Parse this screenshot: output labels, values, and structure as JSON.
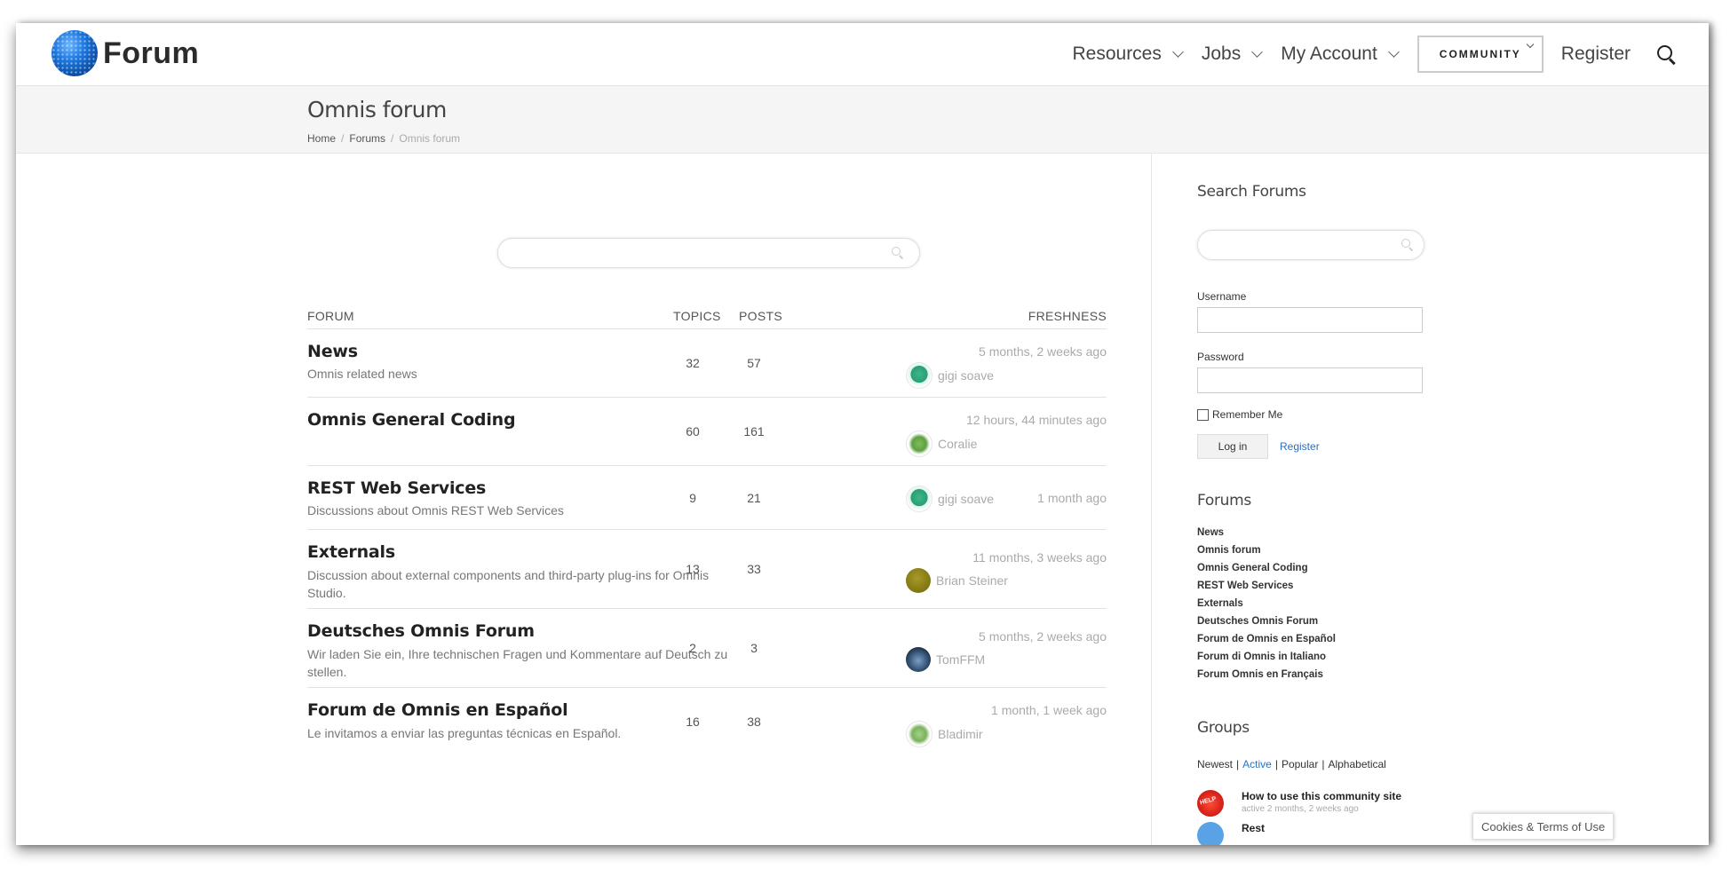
{
  "header": {
    "logo_text": "Forum",
    "nav": {
      "resources": "Resources",
      "jobs": "Jobs",
      "my_account": "My Account",
      "community": "COMMUNITY",
      "register": "Register"
    }
  },
  "titlebar": {
    "title": "Omnis forum",
    "breadcrumb": {
      "home": "Home",
      "forums": "Forums",
      "current": "Omnis forum"
    }
  },
  "table": {
    "headers": {
      "forum": "FORUM",
      "topics": "TOPICS",
      "posts": "POSTS",
      "freshness": "FRESHNESS"
    },
    "rows": [
      {
        "title": "News",
        "desc": "Omnis related news",
        "topics": "32",
        "posts": "57",
        "time": "5 months, 2 weeks ago",
        "author": "gigi soave"
      },
      {
        "title": "Omnis General Coding",
        "desc": "",
        "topics": "60",
        "posts": "161",
        "time": "12 hours, 44 minutes ago",
        "author": "Coralie"
      },
      {
        "title": "REST Web Services",
        "desc": "Discussions about Omnis REST Web Services",
        "topics": "9",
        "posts": "21",
        "time": "1 month ago",
        "author": "gigi soave"
      },
      {
        "title": "Externals",
        "desc": "Discussion about external components and third-party plug-ins for Omnis Studio.",
        "topics": "13",
        "posts": "33",
        "time": "11 months, 3 weeks ago",
        "author": "Brian Steiner"
      },
      {
        "title": "Deutsches Omnis Forum",
        "desc": "Wir laden Sie ein, Ihre technischen Fragen und Kommentare auf Deutsch zu stellen.",
        "topics": "2",
        "posts": "3",
        "time": "5 months, 2 weeks ago",
        "author": "TomFFM"
      },
      {
        "title": "Forum de Omnis en Español",
        "desc": "Le invitamos a enviar las preguntas técnicas en Español.",
        "topics": "16",
        "posts": "38",
        "time": "1 month, 1 week ago",
        "author": "Bladimir"
      }
    ]
  },
  "sidebar": {
    "search_heading": "Search Forums",
    "username_label": "Username",
    "password_label": "Password",
    "remember_label": "Remember Me",
    "login_label": "Log in",
    "register_label": "Register",
    "forums_heading": "Forums",
    "forums": [
      "News",
      "Omnis forum",
      "Omnis General Coding",
      "REST Web Services",
      "Externals",
      "Deutsches Omnis Forum",
      "Forum de Omnis en Español",
      "Forum di Omnis in Italiano",
      "Forum Omnis en Français"
    ],
    "groups_heading": "Groups",
    "group_filters": {
      "newest": "Newest",
      "active": "Active",
      "popular": "Popular",
      "alphabetical": "Alphabetical"
    },
    "groups": [
      {
        "name": "How to use this community site",
        "meta": "active 2 months, 2 weeks ago",
        "badge": "HELP"
      },
      {
        "name": "Rest",
        "meta": ""
      }
    ]
  },
  "cookies_label": "Cookies & Terms of Use",
  "colors": {
    "link": "#2a6fc0",
    "accent": "#1f7ae0"
  }
}
